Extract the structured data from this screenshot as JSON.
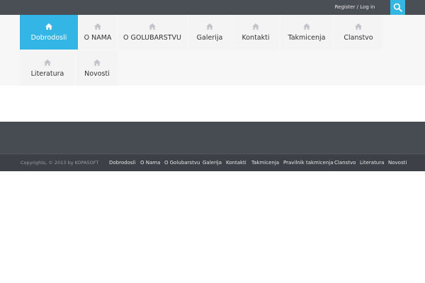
{
  "topbar": {
    "register_label": "Register / Log in",
    "search_icon": "search-icon",
    "accent_color": "#35b7e4"
  },
  "nav": {
    "items": [
      {
        "label": "Dobrodosli",
        "icon": "home-icon",
        "active": true
      },
      {
        "label": "O NAMA",
        "icon": "home-icon"
      },
      {
        "label": "O GOLUBARSTVU",
        "icon": "home-icon"
      },
      {
        "label": "Galerija",
        "icon": "home-icon"
      },
      {
        "label": "Kontakti",
        "icon": "home-icon"
      },
      {
        "label": "Takmicenja",
        "icon": "home-icon"
      },
      {
        "label": "Clanstvo",
        "icon": "home-icon"
      },
      {
        "label": "Literatura",
        "icon": "home-icon"
      },
      {
        "label": "Novosti",
        "icon": "home-icon"
      }
    ]
  },
  "footer": {
    "copyright": "Copyrights, © 2013 by KOPASOFT",
    "links": [
      "Dobrodosli",
      "O Nama",
      "O Golubarstvu",
      "Galerija",
      "Kontakti",
      "Takmicenja",
      "Pravilnik takmicenja",
      "Clanstvo",
      "Literatura",
      "Novosti"
    ]
  }
}
